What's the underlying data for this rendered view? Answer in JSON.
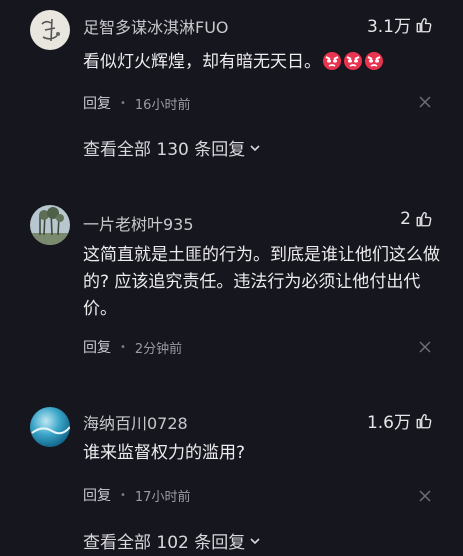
{
  "comments": [
    {
      "username": "足智多谋冰淇淋FUO",
      "likes": "3.1万",
      "text": "看似灯火辉煌，却有暗无天日。",
      "emojis": [
        "angry-face-emoji",
        "angry-face-emoji",
        "angry-face-emoji"
      ],
      "reply_label": "回复",
      "time": "16小时前",
      "view_replies": "查看全部 130 条回复"
    },
    {
      "username": "一片老树叶935",
      "likes": "2",
      "text": "这简直就是土匪的行为。到底是谁让他们这么做的? 应该追究责任。违法行为必须让他付出代价。",
      "reply_label": "回复",
      "time": "2分钟前"
    },
    {
      "username": "海纳百川0728",
      "likes": "1.6万",
      "text": "谁来监督权力的滥用?",
      "reply_label": "回复",
      "time": "17小时前",
      "view_replies": "查看全部 102 条回复"
    }
  ],
  "colors": {
    "background": "#16161e",
    "emoji_red": "#e8344e"
  }
}
